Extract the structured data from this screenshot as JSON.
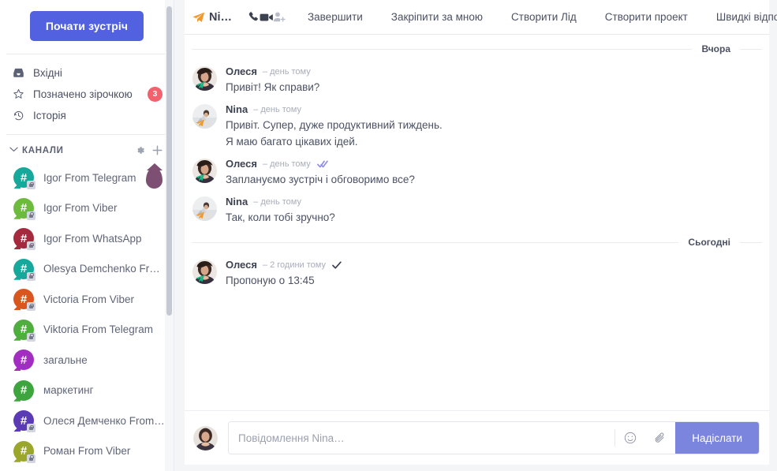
{
  "sidebar": {
    "meet_button": "Почати зустріч",
    "nav": [
      {
        "label": "Вхідні",
        "icon": "inbox-icon",
        "badge": ""
      },
      {
        "label": "Позначено зірочкою",
        "icon": "star-icon",
        "badge": "3"
      },
      {
        "label": "Історія",
        "icon": "history-icon",
        "badge": ""
      }
    ],
    "channels_header": "КАНАЛИ",
    "channels_actions": [
      "gear-icon",
      "plus-icon"
    ],
    "channels": [
      {
        "name": "Igor From Telegram",
        "color": "#16a89a",
        "locked": true,
        "marker": true
      },
      {
        "name": "Igor From Viber",
        "color": "#6cbb3c",
        "locked": true,
        "marker": false
      },
      {
        "name": "Igor From WhatsApp",
        "color": "#a52a3e",
        "locked": true,
        "marker": false
      },
      {
        "name": "Olesya Demchenko Fr…",
        "color": "#16a89a",
        "locked": true,
        "marker": false
      },
      {
        "name": "Victoria From Viber",
        "color": "#d9561f",
        "locked": true,
        "marker": false
      },
      {
        "name": "Viktoria From Telegram",
        "color": "#4fae3e",
        "locked": true,
        "marker": false
      },
      {
        "name": "загальне",
        "color": "#a12ec0",
        "locked": false,
        "marker": false
      },
      {
        "name": "маркетинг",
        "color": "#3ea53e",
        "locked": false,
        "marker": false
      },
      {
        "name": "Олеся Демченко From …",
        "color": "#5b3bb5",
        "locked": true,
        "marker": false
      },
      {
        "name": "Роман From Viber",
        "color": "#9aa62c",
        "locked": true,
        "marker": false
      }
    ],
    "marker_color": "#7c4f73",
    "badge_color": "#f4606c",
    "accent_color": "#5161e0"
  },
  "toolbar": {
    "channel_icon": "telegram-plane-icon",
    "channel_title": "Ni…",
    "icons": [
      "phone-icon",
      "video-camera-icon",
      "add-person-icon"
    ],
    "items": [
      "Завершити",
      "Закріпити за мною",
      "Створити Лід",
      "Створити проект",
      "Швидкі відповіді"
    ]
  },
  "conversation": {
    "groups": [
      {
        "date_label": "Вчора",
        "messages": [
          {
            "author": "Олеся",
            "time": "– день тому",
            "badge": "telegram-green",
            "tick": "none",
            "lines": [
              "Привіт! Як справи?"
            ]
          },
          {
            "author": "Nina",
            "time": "– день тому",
            "badge": "telegram-orange",
            "tick": "none",
            "lines": [
              "Привіт. Супер, дуже продуктивний тиждень.",
              "Я маю багато цікавих ідей."
            ]
          },
          {
            "author": "Олеся",
            "time": "– день тому",
            "badge": "telegram-green",
            "tick": "double",
            "lines": [
              "Заплануємо зустріч і обговоримо все?"
            ]
          },
          {
            "author": "Nina",
            "time": "– день тому",
            "badge": "telegram-orange",
            "tick": "none",
            "lines": [
              "Так, коли тобі зручно?"
            ]
          }
        ]
      },
      {
        "date_label": "Сьогодні",
        "messages": [
          {
            "author": "Олеся",
            "time": "– 2 години тому",
            "badge": "telegram-green",
            "tick": "single",
            "lines": [
              "Пропоную о 13:45"
            ]
          }
        ]
      }
    ]
  },
  "composer": {
    "placeholder": "Повідомлення Nina…",
    "value": "",
    "emoji_icon": "emoji-icon",
    "attach_icon": "paperclip-icon",
    "send_label": "Надіслати",
    "send_color": "#7b85dd"
  }
}
